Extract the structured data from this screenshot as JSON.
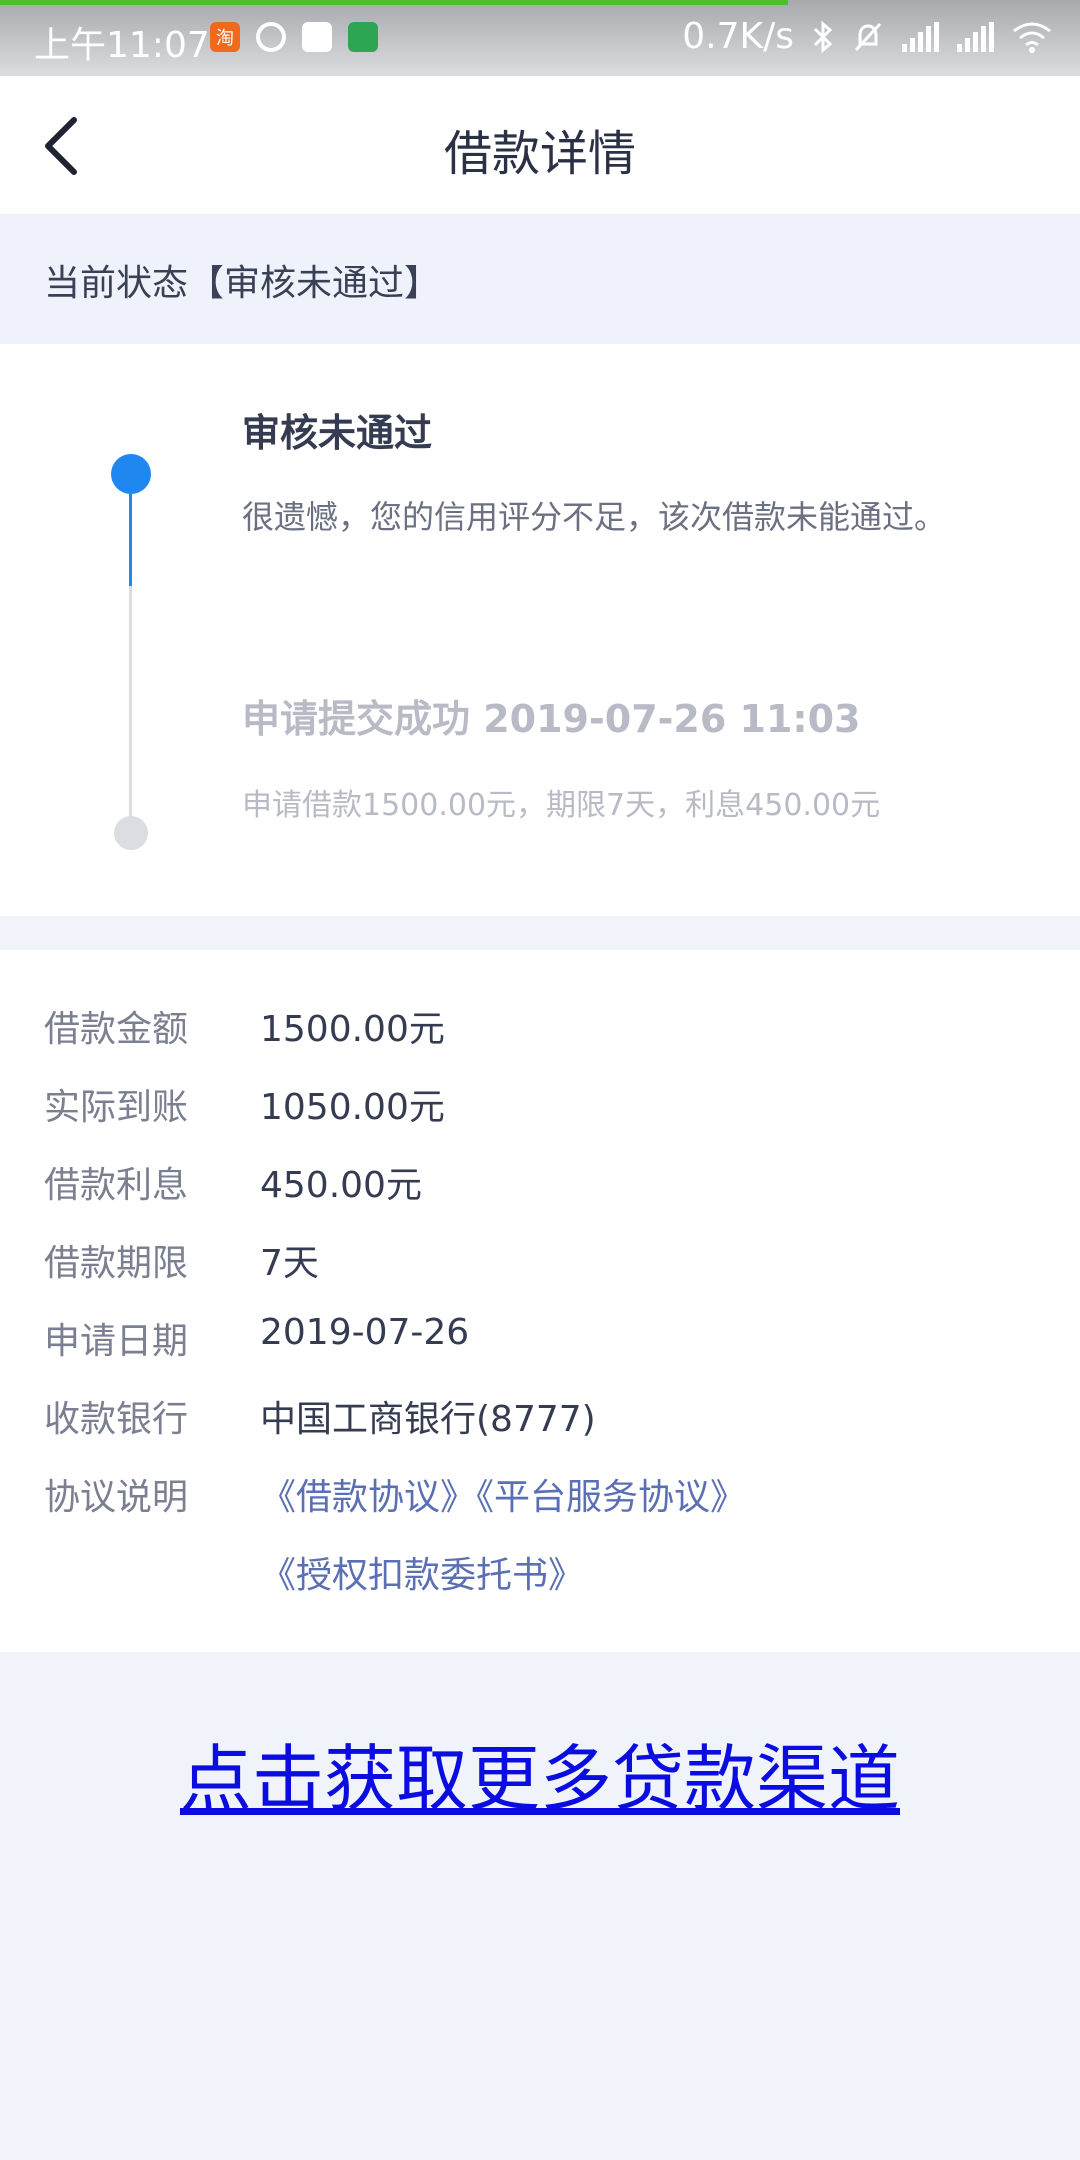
{
  "status_bar": {
    "time": "上午11:07",
    "network_speed": "0.7K/s",
    "notif_taobao": "淘"
  },
  "header": {
    "title": "借款详情"
  },
  "current_status": {
    "text": "当前状态【审核未通过】"
  },
  "timeline": [
    {
      "title": "审核未通过",
      "desc": "很遗憾，您的信用评分不足，该次借款未能通过。"
    },
    {
      "title": "申请提交成功 2019-07-26 11:03",
      "desc": "申请借款1500.00元，期限7天，利息450.00元"
    }
  ],
  "details": [
    {
      "label": "借款金额",
      "value": "1500.00元"
    },
    {
      "label": "实际到账",
      "value": "1050.00元"
    },
    {
      "label": "借款利息",
      "value": "450.00元"
    },
    {
      "label": "借款期限",
      "value": "7天"
    },
    {
      "label": "申请日期",
      "value": "2019-07-26"
    },
    {
      "label": "收款银行",
      "value": "中国工商银行(8777)"
    },
    {
      "label": "协议说明",
      "value": "《借款协议》《平台服务协议》"
    },
    {
      "label": "",
      "value": "《授权扣款委托书》"
    }
  ],
  "more_link": "点击获取更多贷款渠道",
  "colors": {
    "accent": "#1e87f0",
    "link": "#0b0ce0",
    "background": "#f0f3fa"
  }
}
